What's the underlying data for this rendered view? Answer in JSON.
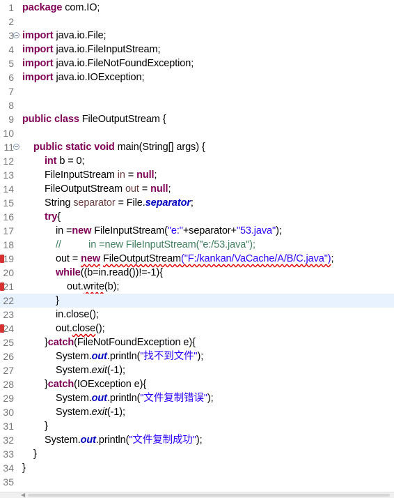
{
  "editor": {
    "lines": [
      {
        "n": "1",
        "t": [
          [
            "kw",
            "package"
          ],
          [
            "",
            "com.IO;"
          ]
        ]
      },
      {
        "n": "2",
        "t": []
      },
      {
        "n": "3",
        "fold": true,
        "t": [
          [
            "kw",
            "import"
          ],
          [
            "",
            "java.io.File;"
          ]
        ]
      },
      {
        "n": "4",
        "t": [
          [
            "kw",
            "import"
          ],
          [
            "",
            "java.io.FileInputStream;"
          ]
        ]
      },
      {
        "n": "5",
        "t": [
          [
            "kw",
            "import"
          ],
          [
            "",
            "java.io.FileNotFoundException;"
          ]
        ]
      },
      {
        "n": "6",
        "t": [
          [
            "kw",
            "import"
          ],
          [
            "",
            "java.io.IOException;"
          ]
        ]
      },
      {
        "n": "7",
        "t": []
      },
      {
        "n": "8",
        "t": []
      },
      {
        "n": "9",
        "t": [
          [
            "kw",
            "public class"
          ],
          [
            "",
            "FileOutputStream {"
          ]
        ]
      },
      {
        "n": "10",
        "t": []
      },
      {
        "n": "11",
        "fold": true,
        "indent": 1,
        "t": [
          [
            "kw",
            "public static void"
          ],
          [
            "",
            " main(String[] args) {"
          ]
        ]
      },
      {
        "n": "12",
        "indent": 2,
        "t": [
          [
            "kw",
            "int"
          ],
          [
            "",
            " b = 0;"
          ]
        ]
      },
      {
        "n": "13",
        "indent": 2,
        "t": [
          [
            "",
            "FileInputStream "
          ],
          [
            "var",
            "in"
          ],
          [
            "",
            " = "
          ],
          [
            "kw",
            "null"
          ],
          [
            "",
            ";"
          ]
        ]
      },
      {
        "n": "14",
        "indent": 2,
        "t": [
          [
            "",
            "FileOutputStream "
          ],
          [
            "var",
            "out"
          ],
          [
            "",
            " = "
          ],
          [
            "kw",
            "null"
          ],
          [
            "",
            ";"
          ]
        ]
      },
      {
        "n": "15",
        "indent": 2,
        "t": [
          [
            "",
            "String "
          ],
          [
            "var",
            "separator"
          ],
          [
            "",
            " = File."
          ],
          [
            "stat",
            "separator"
          ],
          [
            "",
            ";"
          ]
        ]
      },
      {
        "n": "16",
        "indent": 2,
        "t": [
          [
            "kw",
            "try"
          ],
          [
            "",
            "{"
          ]
        ]
      },
      {
        "n": "17",
        "indent": 3,
        "t": [
          [
            "",
            "in ="
          ],
          [
            "kw",
            "new"
          ],
          [
            "",
            " FileInputStream("
          ],
          [
            "str",
            "\"e:\""
          ],
          [
            "",
            "+separator+"
          ],
          [
            "str",
            "\"53.java\""
          ],
          [
            "",
            ");"
          ]
        ]
      },
      {
        "n": "18",
        "indent": 3,
        "t": [
          [
            "cmt",
            "//          in =new FileInputStream(\"e:/53.java\");"
          ]
        ]
      },
      {
        "n": "19",
        "marker": true,
        "indent": 3,
        "t": [
          [
            "",
            "out = "
          ],
          [
            "kw err",
            "new"
          ],
          [
            "",
            " "
          ],
          [
            "err",
            "FileOutputStream"
          ],
          [
            "",
            ""
          ],
          [
            "str err",
            "(\"F:/kankan/VaCache/A/B/C.java\")"
          ],
          [
            "",
            ";"
          ]
        ]
      },
      {
        "n": "20",
        "indent": 3,
        "t": [
          [
            "kw",
            "while"
          ],
          [
            "",
            "((b=in.read())!=-1){"
          ]
        ]
      },
      {
        "n": "21",
        "marker": true,
        "indent": 4,
        "t": [
          [
            "",
            "out."
          ],
          [
            "err",
            "write"
          ],
          [
            "",
            "(b);"
          ]
        ]
      },
      {
        "n": "22",
        "current": true,
        "indent": 3,
        "t": [
          [
            "",
            "}"
          ]
        ]
      },
      {
        "n": "23",
        "indent": 3,
        "t": [
          [
            "",
            "in.close();"
          ]
        ]
      },
      {
        "n": "24",
        "marker": true,
        "indent": 3,
        "t": [
          [
            "",
            "out."
          ],
          [
            "err",
            "close"
          ],
          [
            "",
            "();"
          ]
        ]
      },
      {
        "n": "25",
        "indent": 2,
        "t": [
          [
            "",
            "}"
          ],
          [
            "kw",
            "catch"
          ],
          [
            "",
            "(FileNotFoundException e){"
          ]
        ]
      },
      {
        "n": "26",
        "indent": 3,
        "t": [
          [
            "",
            "System."
          ],
          [
            "stat",
            "out"
          ],
          [
            "",
            ".println("
          ],
          [
            "str",
            "\"找不到文件\""
          ],
          [
            "",
            ");"
          ]
        ]
      },
      {
        "n": "27",
        "indent": 3,
        "t": [
          [
            "",
            "System."
          ],
          [
            "statm",
            "exit"
          ],
          [
            "",
            "(-1);"
          ]
        ]
      },
      {
        "n": "28",
        "indent": 2,
        "t": [
          [
            "",
            "}"
          ],
          [
            "kw",
            "catch"
          ],
          [
            "",
            "(IOException e){"
          ]
        ]
      },
      {
        "n": "29",
        "indent": 3,
        "t": [
          [
            "",
            "System."
          ],
          [
            "stat",
            "out"
          ],
          [
            "",
            ".println("
          ],
          [
            "str",
            "\"文件复制错误\""
          ],
          [
            "",
            ");"
          ]
        ]
      },
      {
        "n": "30",
        "indent": 3,
        "t": [
          [
            "",
            "System."
          ],
          [
            "statm",
            "exit"
          ],
          [
            "",
            "(-1);"
          ]
        ]
      },
      {
        "n": "31",
        "indent": 2,
        "t": [
          [
            "",
            "}"
          ]
        ]
      },
      {
        "n": "32",
        "indent": 2,
        "t": [
          [
            "",
            "System."
          ],
          [
            "stat",
            "out"
          ],
          [
            "",
            ".println("
          ],
          [
            "str",
            "\"文件复制成功\""
          ],
          [
            "",
            ");"
          ]
        ]
      },
      {
        "n": "33",
        "indent": 1,
        "t": [
          [
            "",
            "}"
          ]
        ]
      },
      {
        "n": "34",
        "t": [
          [
            "",
            "}"
          ]
        ]
      },
      {
        "n": "35",
        "t": []
      }
    ]
  }
}
